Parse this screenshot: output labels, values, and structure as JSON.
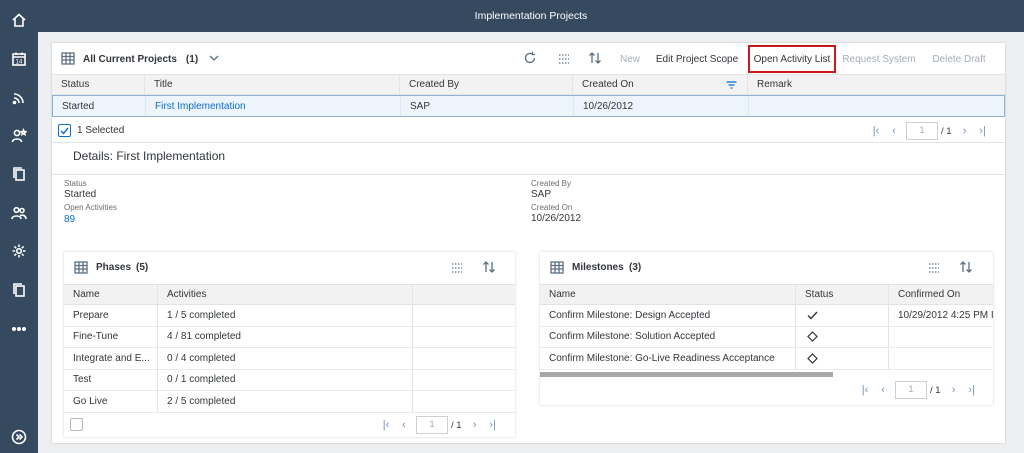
{
  "shell": {
    "title": "Implementation Projects"
  },
  "rail": {
    "icons": [
      "home-icon",
      "calendar-icon",
      "feed-icon",
      "user-favorite-icon",
      "copy-icon",
      "group-icon",
      "settings-icon",
      "copy-icon",
      "more-icon",
      "expand-icon"
    ],
    "calendar_day": "14"
  },
  "projects": {
    "title": "All Current Projects",
    "count": "(1)",
    "buttons": {
      "new": "New",
      "edit_scope": "Edit Project Scope",
      "open_activity_list": "Open Activity List",
      "request_system": "Request System",
      "delete_draft": "Delete Draft"
    },
    "columns": [
      "Status",
      "Title",
      "Created By",
      "Created On",
      "Remark"
    ],
    "rows": [
      {
        "status": "Started",
        "title": "First Implementation",
        "created_by": "SAP",
        "created_on": "10/26/2012",
        "remark": ""
      }
    ],
    "selected_text": "1 Selected",
    "pager": {
      "page": "1",
      "total": "/ 1"
    }
  },
  "details": {
    "title": "Details: First Implementation",
    "status_label": "Status",
    "status_value": "Started",
    "open_label": "Open Activities",
    "open_value": "89",
    "created_by_label": "Created By",
    "created_by_value": "SAP",
    "created_on_label": "Created On",
    "created_on_value": "10/26/2012"
  },
  "phases": {
    "title": "Phases",
    "count": "(5)",
    "columns": [
      "Name",
      "Activities"
    ],
    "rows": [
      {
        "name": "Prepare",
        "activities": "1 / 5 completed"
      },
      {
        "name": "Fine-Tune",
        "activities": "4 / 81 completed"
      },
      {
        "name": "Integrate and E...",
        "activities": "0 / 4 completed"
      },
      {
        "name": "Test",
        "activities": "0 / 1 completed"
      },
      {
        "name": "Go Live",
        "activities": "2 / 5 completed"
      }
    ],
    "pager": {
      "page": "1",
      "total": "/ 1"
    }
  },
  "milestones": {
    "title": "Milestones",
    "count": "(3)",
    "columns": [
      "Name",
      "Status",
      "Confirmed On"
    ],
    "rows": [
      {
        "name": "Confirm Milestone: Design Accepted",
        "status_icon": "checkmark-icon",
        "confirmed_on": "10/29/2012 4:25 PM I"
      },
      {
        "name": "Confirm Milestone: Solution Accepted",
        "status_icon": "diamond-icon",
        "confirmed_on": ""
      },
      {
        "name": "Confirm Milestone: Go-Live Readiness Acceptance",
        "status_icon": "diamond-icon",
        "confirmed_on": ""
      }
    ],
    "pager": {
      "page": "1",
      "total": "/ 1"
    }
  },
  "colors": {
    "shell": "#354a5f",
    "link": "#0a6ed1",
    "highlight": "#c8191f",
    "selected_row": "#eef4fb"
  }
}
